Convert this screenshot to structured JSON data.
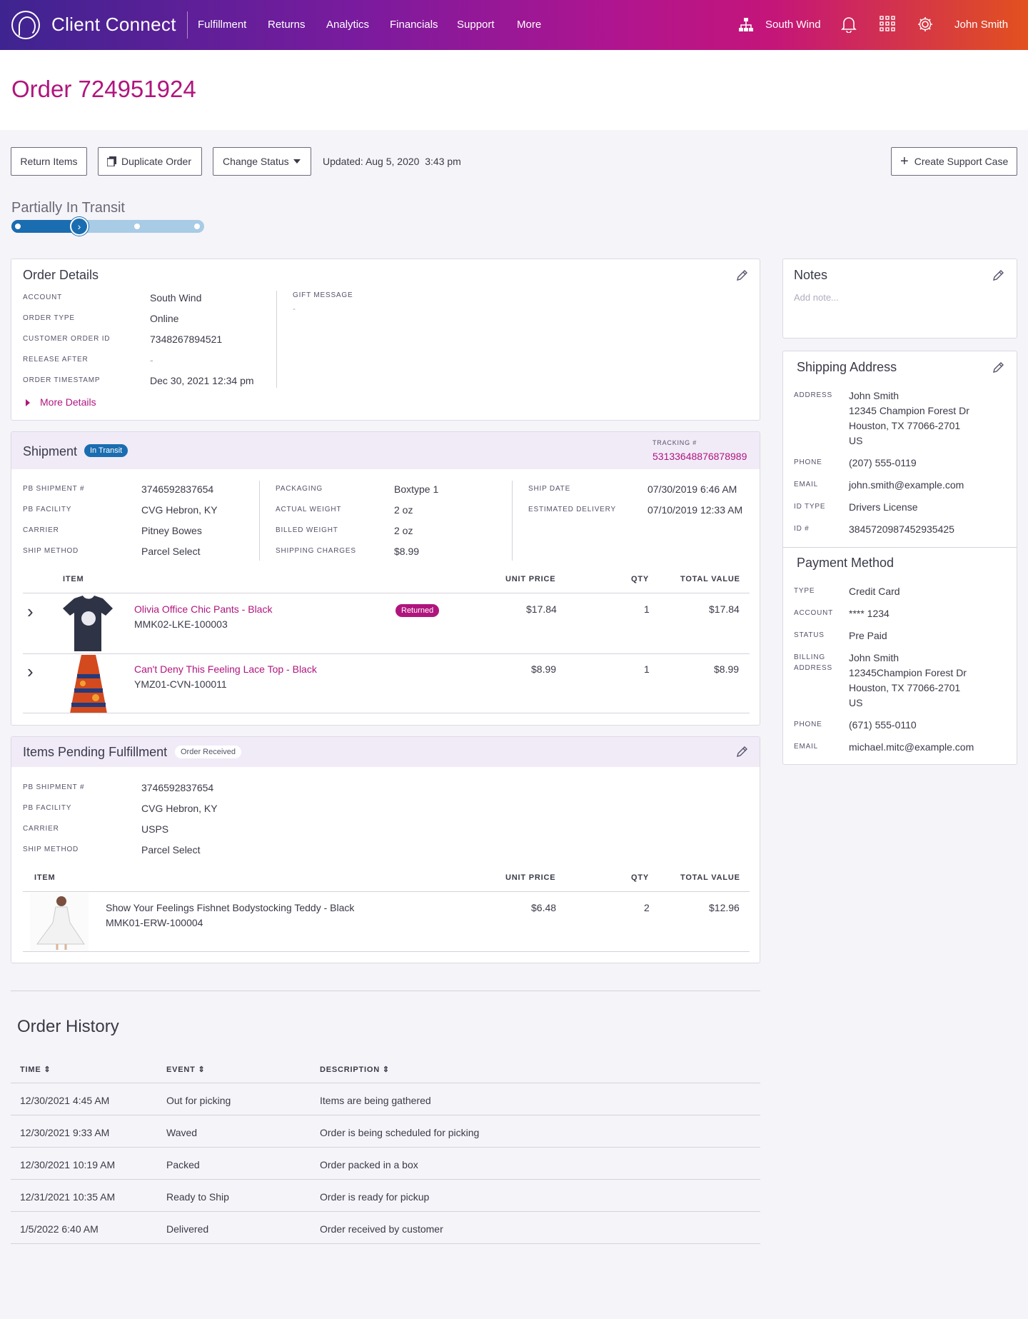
{
  "nav": {
    "brand": "Client Connect",
    "items": [
      "Fulfillment",
      "Returns",
      "Analytics",
      "Financials",
      "Support",
      "More"
    ],
    "account": "South Wind",
    "user": "John Smith"
  },
  "page": {
    "title": "Order 724951924"
  },
  "toolbar": {
    "return_items": "Return Items",
    "duplicate_order": "Duplicate Order",
    "change_status": "Change Status",
    "updated": "Updated: Aug 5, 2020  3:43 pm",
    "create_case": "Create Support Case"
  },
  "status": {
    "label": "Partially In Transit",
    "steps": 4,
    "current_step": 2
  },
  "order_details": {
    "title": "Order Details",
    "fields": [
      {
        "label": "ACCOUNT",
        "value": "South Wind"
      },
      {
        "label": "ORDER TYPE",
        "value": "Online"
      },
      {
        "label": "CUSTOMER ORDER ID",
        "value": "7348267894521"
      },
      {
        "label": "RELEASE AFTER",
        "value": "-"
      },
      {
        "label": "ORDER TIMESTAMP",
        "value": "Dec 30, 2021 12:34 pm"
      }
    ],
    "gift_label": "GIFT MESSAGE",
    "gift_value": "-",
    "more": "More Details"
  },
  "shipment": {
    "title": "Shipment",
    "badge": "In Transit",
    "tracking_label": "TRACKING #",
    "tracking": "53133648876878989",
    "col1": [
      {
        "label": "PB SHIPMENT #",
        "value": "3746592837654"
      },
      {
        "label": "PB FACILITY",
        "value": "CVG Hebron, KY"
      },
      {
        "label": "CARRIER",
        "value": "Pitney Bowes"
      },
      {
        "label": "SHIP METHOD",
        "value": "Parcel Select"
      }
    ],
    "col2": [
      {
        "label": "PACKAGING",
        "value": "Boxtype 1"
      },
      {
        "label": "ACTUAL WEIGHT",
        "value": "2 oz"
      },
      {
        "label": "BILLED WEIGHT",
        "value": "2 oz"
      },
      {
        "label": "SHIPPING CHARGES",
        "value": "$8.99"
      }
    ],
    "col3": [
      {
        "label": "SHIP DATE",
        "value": "07/30/2019 6:46 AM"
      },
      {
        "label": "ESTIMATED DELIVERY",
        "value": "07/10/2019 12:33 AM"
      }
    ],
    "headers": {
      "item": "ITEM",
      "unit": "UNIT PRICE",
      "qty": "QTY",
      "total": "TOTAL VALUE"
    },
    "items": [
      {
        "name": "Olivia Office Chic Pants - Black",
        "sku": "MMK02-LKE-100003",
        "badge": "Returned",
        "unit": "$17.84",
        "qty": "1",
        "total": "$17.84"
      },
      {
        "name": "Can't Deny This Feeling Lace Top - Black",
        "sku": "YMZ01-CVN-100011",
        "badge": "",
        "unit": "$8.99",
        "qty": "1",
        "total": "$8.99"
      }
    ]
  },
  "pending": {
    "title": "Items Pending Fulfillment",
    "badge": "Order Received",
    "fields": [
      {
        "label": "PB SHIPMENT #",
        "value": "3746592837654"
      },
      {
        "label": "PB FACILITY",
        "value": "CVG Hebron, KY"
      },
      {
        "label": "CARRIER",
        "value": "USPS"
      },
      {
        "label": "SHIP METHOD",
        "value": "Parcel Select"
      }
    ],
    "headers": {
      "item": "ITEM",
      "unit": "UNIT PRICE",
      "qty": "QTY",
      "total": "TOTAL VALUE"
    },
    "items": [
      {
        "name": "Show Your Feelings Fishnet Bodystocking Teddy - Black",
        "sku": "MMK01-ERW-100004",
        "unit": "$6.48",
        "qty": "2",
        "total": "$12.96"
      }
    ]
  },
  "notes": {
    "title": "Notes",
    "placeholder": "Add note..."
  },
  "shipping_address": {
    "title": "Shipping Address",
    "address_label": "ADDRESS",
    "address": [
      "John Smith",
      "12345 Champion Forest Dr",
      "Houston, TX 77066-2701",
      "US"
    ],
    "fields": [
      {
        "label": "PHONE",
        "value": "(207) 555-0119"
      },
      {
        "label": "EMAIL",
        "value": "john.smith@example.com"
      },
      {
        "label": "ID TYPE",
        "value": "Drivers License"
      },
      {
        "label": "ID #",
        "value": "3845720987452935425"
      }
    ]
  },
  "payment": {
    "title": "Payment Method",
    "fields": [
      {
        "label": "TYPE",
        "value": "Credit Card"
      },
      {
        "label": "ACCOUNT",
        "value": "**** 1234"
      },
      {
        "label": "STATUS",
        "value": "Pre Paid"
      }
    ],
    "billing_label_1": "BILLING",
    "billing_label_2": "ADDRESS",
    "billing": [
      "John Smith",
      "12345Champion Forest Dr",
      "Houston, TX 77066-2701",
      "US"
    ],
    "fields2": [
      {
        "label": "PHONE",
        "value": "(671) 555-0110"
      },
      {
        "label": "EMAIL",
        "value": "michael.mitc@example.com"
      }
    ]
  },
  "history": {
    "title": "Order History",
    "headers": [
      "TIME",
      "EVENT",
      "DESCRIPTION"
    ],
    "rows": [
      [
        "12/30/2021 4:45 AM",
        "Out for picking",
        "Items are being gathered"
      ],
      [
        "12/30/2021 9:33 AM",
        "Waved",
        "Order is being scheduled for picking"
      ],
      [
        "12/30/2021 10:19 AM",
        "Packed",
        "Order packed in a box"
      ],
      [
        "12/31/2021 10:35 AM",
        "Ready to Ship",
        "Order is ready for pickup"
      ],
      [
        "1/5/2022 6:40 AM",
        "Delivered",
        "Order received by customer"
      ]
    ]
  },
  "colors": {
    "brand": "#b0157e",
    "transit": "#1a6db0"
  }
}
